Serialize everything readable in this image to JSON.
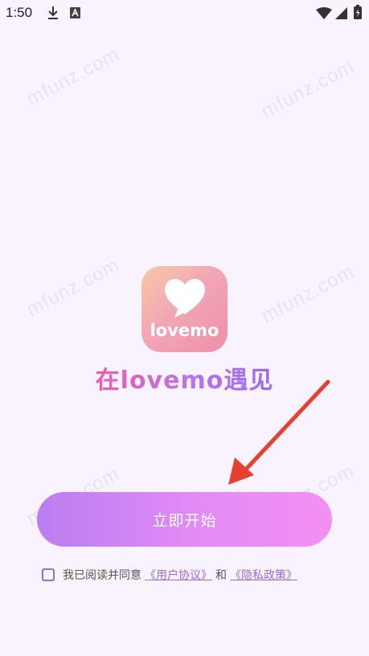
{
  "status_bar": {
    "time": "1:50",
    "left_icons": [
      "download-icon",
      "text-a-icon"
    ],
    "right_icons": [
      "wifi-icon",
      "signal-icon",
      "battery-icon"
    ]
  },
  "watermark": {
    "text": "mfunz.com"
  },
  "logo": {
    "text": "lovemo"
  },
  "headline": "在lovemo遇见",
  "start_button": {
    "label": "立即开始"
  },
  "agreement": {
    "checked": false,
    "prefix": "我已阅读并同意",
    "user_agreement": "《用户协议》",
    "conjunction": "和",
    "privacy_policy": "《隐私政策》"
  },
  "annotation": {
    "arrow_color": "#e8402e"
  },
  "colors": {
    "background": "#f8f3fd",
    "accent": "#9b6bd8",
    "button_gradient_start": "#b97ef1",
    "button_gradient_end": "#f48ff3"
  }
}
